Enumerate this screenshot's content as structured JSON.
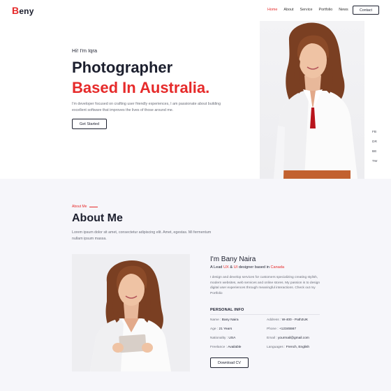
{
  "brand": {
    "first_letter": "B",
    "rest": "eny"
  },
  "nav": {
    "items": [
      {
        "label": "Home",
        "active": true
      },
      {
        "label": "About",
        "active": false
      },
      {
        "label": "Service",
        "active": false
      },
      {
        "label": "Portfolio",
        "active": false
      },
      {
        "label": "News",
        "active": false
      }
    ],
    "contact_label": "Contact"
  },
  "hero": {
    "greeting": "Hi! I'm Iqra",
    "title_line1": "Photographer",
    "title_line2": "Based In Australia.",
    "description": "I'm developer focused on crafting user friendly experiences, I am passionate about building excellent software that improves the lives of those around me.",
    "cta_label": "Get Started",
    "social": [
      "FB",
      "DR",
      "BE",
      "TW"
    ]
  },
  "about": {
    "tag": "About Me",
    "title": "About Me",
    "description": "Lorem ipsum dolor sit amet, consectetur adipiscing elit. Amet, egestas. Mi fermentum nullam ipsum massa.",
    "name": "I'm Bany Naira",
    "role_prefix": "A Lead ",
    "role_ux": "UX",
    "role_amp": " & ",
    "role_ui": "UI",
    "role_mid": " designer based in ",
    "role_place": "Canada",
    "bio": "I design and develop services for customers specializing creating stylish, modern websites, web services and online stores. My passion is to design digital user experiences through meaningful interactions. Check out my Portfolio",
    "personal_info_title": "PERSONAL INFO",
    "info": {
      "name_label": "Name : ",
      "name_value": "Bany Naira",
      "age_label": "Age : ",
      "age_value": "21 Years",
      "nationality_label": "Nationality : ",
      "nationality_value": "USA",
      "freelance_label": "Freelance : ",
      "freelance_value": "Available",
      "address_label": "Address : ",
      "address_value": "W-400 - Path3UK",
      "phone_label": "Phone : ",
      "phone_value": "+12345567",
      "email_label": "Email : ",
      "email_value": "yourmail@gmail.com",
      "languages_label": "Languages : ",
      "languages_value": "French, English"
    },
    "download_label": "Download CV"
  },
  "colors": {
    "accent": "#e62a2a",
    "dark": "#1c1f2e",
    "about_bg": "#f6f6fa"
  }
}
